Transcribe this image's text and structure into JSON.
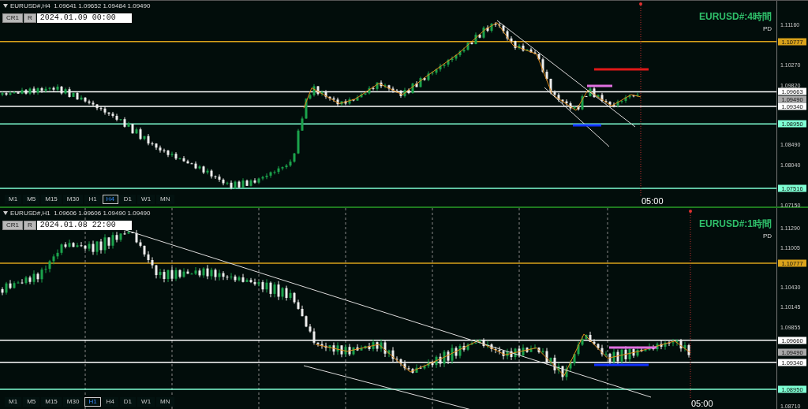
{
  "charts": [
    {
      "header": "EURUSD#,H4  1.09641 1.09652 1.09484 1.09490",
      "buttons": [
        "CR1",
        "R"
      ],
      "date": "2024.01.09 00:00",
      "title": "EURUSD#:4時間",
      "subtitle": "PD",
      "time_label": "05:00",
      "axis_ticks": [
        "1.11160",
        "1.10270",
        "1.09820",
        "1.08490",
        "1.08040",
        "1.07150"
      ],
      "levels": [
        {
          "price": "1.10777",
          "color": "#d9a21b",
          "kind": "line"
        },
        {
          "price": "1.09663",
          "color": "#ffffff",
          "kind": "line"
        },
        {
          "price": "1.09490",
          "color": "#a8a8a8",
          "kind": "bid"
        },
        {
          "price": "1.09340",
          "color": "#ffffff",
          "kind": "line"
        },
        {
          "price": "1.08950",
          "color": "#7fffd4",
          "kind": "line"
        },
        {
          "price": "1.07516",
          "color": "#7fffd4",
          "kind": "line"
        }
      ],
      "timeframes": [
        {
          "label": "M1",
          "selected": false
        },
        {
          "label": "M5",
          "selected": false
        },
        {
          "label": "M15",
          "selected": false
        },
        {
          "label": "M30",
          "selected": false
        },
        {
          "label": "H1",
          "selected": false
        },
        {
          "label": "H4",
          "selected": true
        },
        {
          "label": "D1",
          "selected": false
        },
        {
          "label": "W1",
          "selected": false
        },
        {
          "label": "MN",
          "selected": false
        }
      ]
    },
    {
      "header": "EURUSD#,H1  1.09606 1.09606 1.09490 1.09490",
      "buttons": [
        "CR1",
        "R"
      ],
      "date": "2024.01.08 22:00",
      "title": "EURUSD#:1時間",
      "subtitle": "PD",
      "time_label": "05:00",
      "axis_ticks": [
        "1.11290",
        "1.11005",
        "1.10430",
        "1.10145",
        "1.09855",
        "1.08710"
      ],
      "levels": [
        {
          "price": "1.10777",
          "color": "#d9a21b",
          "kind": "line"
        },
        {
          "price": "1.09660",
          "color": "#ffffff",
          "kind": "line"
        },
        {
          "price": "1.09490",
          "color": "#a8a8a8",
          "kind": "bid"
        },
        {
          "price": "1.09340",
          "color": "#ffffff",
          "kind": "line"
        },
        {
          "price": "1.08950",
          "color": "#7fffd4",
          "kind": "line"
        }
      ],
      "timeframes": [
        {
          "label": "M1",
          "selected": false
        },
        {
          "label": "M5",
          "selected": false
        },
        {
          "label": "M15",
          "selected": false
        },
        {
          "label": "M30",
          "selected": false
        },
        {
          "label": "H1",
          "selected": true
        },
        {
          "label": "H4",
          "selected": false
        },
        {
          "label": "D1",
          "selected": false
        },
        {
          "label": "W1",
          "selected": false
        },
        {
          "label": "MN",
          "selected": false
        }
      ]
    }
  ]
}
